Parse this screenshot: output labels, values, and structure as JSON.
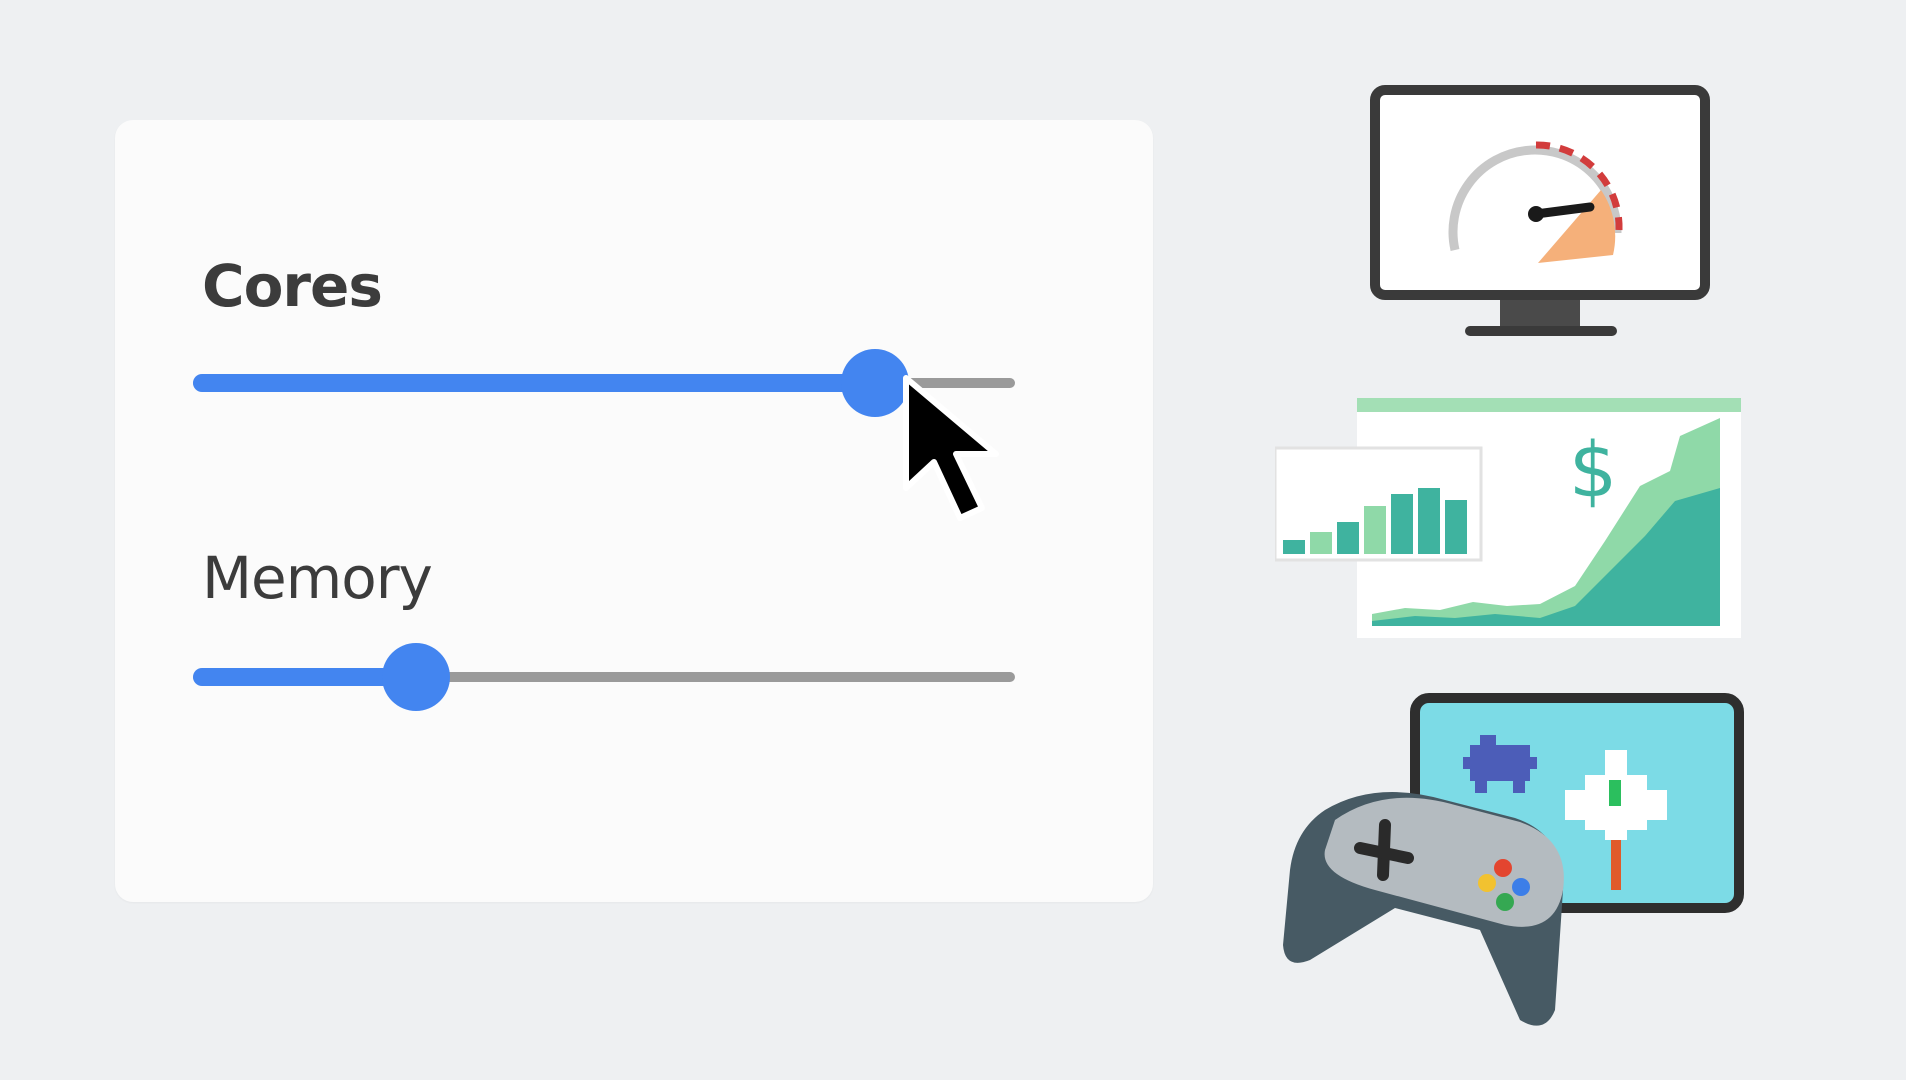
{
  "colors": {
    "accent": "#4385f0",
    "track": "#9a9a9a",
    "background": "#eef0f2",
    "card": "#fbfbfb"
  },
  "cores": {
    "label": "Cores",
    "value_fraction": 0.86
  },
  "memory": {
    "label": "Memory",
    "value_fraction": 0.25
  },
  "illustrations": {
    "performance": "monitor-speedometer-icon",
    "finance": "dollar-growth-charts-icon",
    "gaming": "gamepad-tablet-icon",
    "currency_symbol": "$"
  }
}
